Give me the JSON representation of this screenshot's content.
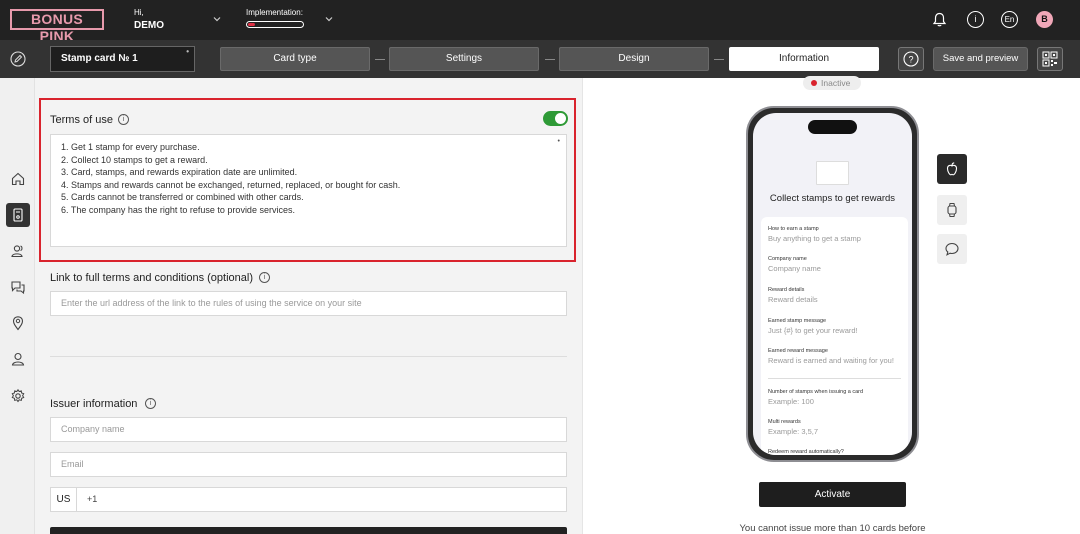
{
  "brand": {
    "logo_text": "BONUS PINK"
  },
  "user": {
    "greeting": "Hi,",
    "name": "DEMO",
    "avatar_letter": "B"
  },
  "implementation": {
    "label": "Implementation:",
    "progress_fraction": 0.12
  },
  "topbar": {
    "language": "En"
  },
  "navbar": {
    "card_name": "Stamp card № 1",
    "steps": [
      "Card type",
      "Settings",
      "Design",
      "Information"
    ],
    "active_step": "Information",
    "save_label": "Save and preview"
  },
  "form": {
    "terms_title": "Terms of use",
    "terms_enabled": true,
    "terms_lines": [
      "1. Get 1 stamp for every purchase.",
      "2. Collect 10 stamps to get a reward.",
      "3. Card, stamps, and rewards expiration date are unlimited.",
      "4. Stamps and rewards cannot be exchanged, returned, replaced, or bought for cash.",
      "5. Cards cannot be transferred or combined with other cards.",
      "6. The company has the right to refuse to provide services."
    ],
    "link_title": "Link to full terms and conditions (optional)",
    "link_placeholder": "Enter the url address of the link to the rules of using the service on your site",
    "issuer_title": "Issuer information",
    "company_placeholder": "Company name",
    "email_placeholder": "Email",
    "phone_country": "US",
    "phone_prefix": "+1"
  },
  "preview": {
    "status": "Inactive",
    "phone_title": "Collect stamps to get rewards",
    "fields": [
      {
        "label": "How to earn a stamp",
        "value": "Buy anything to get a stamp"
      },
      {
        "label": "Company name",
        "value": "Company name"
      },
      {
        "label": "Reward details",
        "value": "Reward details"
      },
      {
        "label": "Earned stamp message",
        "value": "Just {#} to get your reward!"
      },
      {
        "label": "Earned reward message",
        "value": "Reward is earned and waiting for you!"
      },
      {
        "label": "Number of stamps when issuing a card",
        "value": "Example: 100"
      },
      {
        "label": "Multi rewards",
        "value": "Example: 3,5,7"
      },
      {
        "label": "Redeem reward automatically?",
        "value": ""
      }
    ],
    "activate_label": "Activate",
    "notice": "You cannot issue more than 10 cards before"
  },
  "colors": {
    "accent_pink": "#e79aac",
    "toggle_green": "#2e9a36",
    "highlight_red": "#d9232d",
    "inactive_dot": "#d9232d"
  },
  "icons": [
    "notifications-bell-icon",
    "info-icon",
    "language-icon",
    "user-avatar",
    "edit-pencil-icon",
    "help-icon",
    "qr-code-icon",
    "home-icon",
    "card-icon",
    "users-icon",
    "chat-icon",
    "location-icon",
    "manager-icon",
    "gear-icon",
    "apple-icon",
    "watch-icon",
    "message-icon"
  ]
}
